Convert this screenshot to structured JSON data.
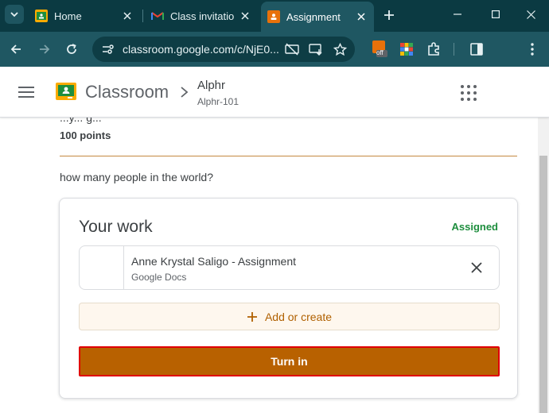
{
  "browser": {
    "tabs": [
      {
        "label": "Home",
        "favicon": "classroom-icon"
      },
      {
        "label": "Class invitation",
        "favicon": "gmail-icon"
      },
      {
        "label": "Assignment",
        "favicon": "assignment-icon",
        "active": true
      }
    ],
    "url": "classroom.google.com/c/NjE0...",
    "extension_badge": "off"
  },
  "header": {
    "app_name": "Classroom",
    "class_name": "Alphr",
    "class_section": "Alphr-101"
  },
  "assignment": {
    "cut_off_text": "...y... g...",
    "points": "100 points",
    "question": "how many people in the world?"
  },
  "your_work": {
    "title": "Your work",
    "status": "Assigned",
    "attachment": {
      "name": "Anne Krystal Saligo - Assignment",
      "type": "Google Docs"
    },
    "add_label": "Add or create",
    "turn_in_label": "Turn in"
  },
  "colors": {
    "browser_frame": "#0b3a42",
    "toolbar": "#1f5762",
    "accent": "#b86100",
    "status_green": "#1e8e3e"
  }
}
